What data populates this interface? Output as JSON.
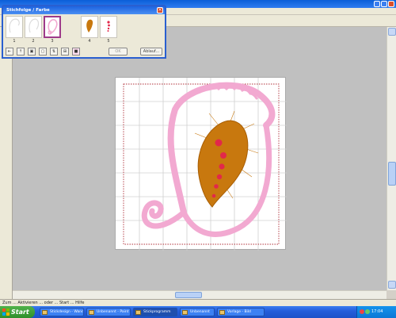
{
  "palette": {
    "title": "Stichfolge / Farbe",
    "swatches": [
      {
        "label": "1",
        "color": "#e7e7e7"
      },
      {
        "label": "2",
        "color": "#e7e7e7"
      },
      {
        "label": "3",
        "color": "#f2a9d1"
      },
      {
        "label": "4",
        "color": "#c8780e"
      },
      {
        "label": "5",
        "color": "#e2284a"
      }
    ],
    "selected_index": 2,
    "ok_label": "OK",
    "more_label": "Ablauf..."
  },
  "status": {
    "text": "Zum ... Aktivieren ... oder ... Start ... Hilfe"
  },
  "taskbar": {
    "start_label": "Start",
    "items": [
      "Stickdesign - Wand",
      "Unbenannt - Paint",
      "Stickprogramm",
      "Unbenannt",
      "Vorlage - Bild"
    ],
    "clock": "17:04"
  },
  "colors": {
    "outline_pink": "#f2a9d1",
    "fill_brown": "#c8780e",
    "dots_red": "#e2284a",
    "grid": "#d0d0d0",
    "hoop": "#b0303a"
  }
}
